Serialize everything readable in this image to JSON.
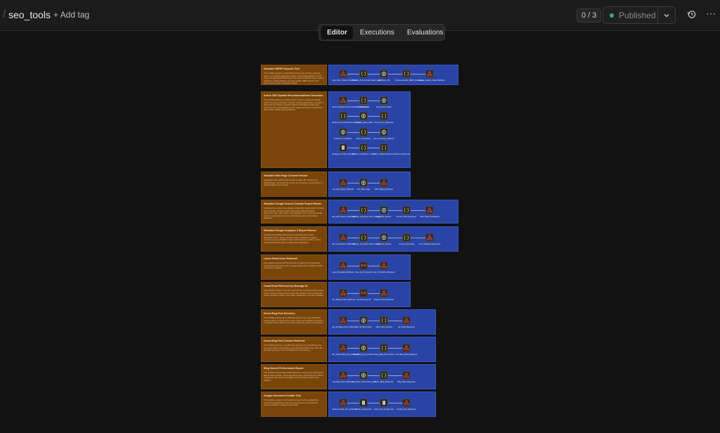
{
  "header": {
    "workflow_name": "seo_tools",
    "add_tag_label": "+ Add tag",
    "counter": "0 / 3",
    "publish_label": "Published",
    "icons": {
      "dropdown": "chevron-down-icon",
      "history": "history-icon",
      "more": "more-horizontal-icon"
    }
  },
  "tabs": [
    {
      "label": "Editor",
      "active": true
    },
    {
      "label": "Executions",
      "active": false
    },
    {
      "label": "Evaluations",
      "active": false
    }
  ],
  "colors": {
    "sticky": "#7a4509",
    "group": "#2944a6",
    "trigger_icon": "#e0484e",
    "code_icon": "#e8b24a",
    "http_icon": "#c8c8c8"
  },
  "sections": [
    {
      "title": "Standard SERP Keyword Tool",
      "description": "This workflow accepts a configurable search query, location, language, device, and a target organization setting, and forwards payload. Use the request through DataForSEO and returns clean structured results, related questions, related searches, top-stories results, SERP features, and optional rank position tracking information.",
      "nodes": [
        {
          "icon": "trigger",
          "label": "Keep_Serp_Search_Webhook"
        },
        {
          "icon": "code",
          "label": "Validate_And_Format_Search_Input"
        },
        {
          "icon": "http",
          "label": "Call_Serp_API"
        },
        {
          "icon": "code",
          "label": "Format_Results_SERP_Response"
        },
        {
          "icon": "trigger",
          "label": "Google_Search_Data_Webhook"
        }
      ]
    },
    {
      "title": "Article SEO Update Recommendations Generator",
      "description": "This workflow gathers an existing article's content, analyzes its Google Search Console performance, identifies ranking opportunities, compares it against the top ranking competitor pages for the target keyword, and returns all of the data needed for an AI model to generate comprehensive SEO content update recommendations.",
      "nodes": [
        {
          "icon": "trigger",
          "label": "Article_Update_Recommendations_Webhook"
        },
        {
          "icon": "code",
          "label": "Validate_Input"
        },
        {
          "icon": "http",
          "label": "Get_Article_Pages"
        },
        {
          "icon": "code",
          "label": "Extract_Recommendations_Content"
        },
        {
          "icon": "http",
          "label": "Get_Gsc_Query_Data"
        },
        {
          "icon": "code",
          "label": "Format_Gsc_Response"
        },
        {
          "icon": "http",
          "label": "Retrieve_Competitors"
        },
        {
          "icon": "code",
          "label": "Filter_Competitors"
        },
        {
          "icon": "http",
          "label": "Get_Competitor_Webinfo"
        },
        {
          "icon": "page",
          "label": "Webpage_Content_Extractor"
        },
        {
          "icon": "code",
          "label": "Extract_Competitor_Content"
        },
        {
          "icon": "code",
          "label": "Article_Update_Recommendations_Response"
        }
      ]
    },
    {
      "title": "Standard Web Page Content Fetcher",
      "description": "Lightweight utility workflow that accepts a public URL, retrieves the rendered page, and returns the content for summaries, summarization, or further analysis by an AI agent.",
      "nodes": [
        {
          "icon": "trigger",
          "label": "Get_Web_Page_Webhook"
        },
        {
          "icon": "http",
          "label": "Get_Web_Page"
        },
        {
          "icon": "trigger",
          "label": "Web_Page_Response"
        }
      ]
    },
    {
      "title": "Standard Google Search Console Report Router",
      "description": "Schedule this workflow that validates configurable Google Search Console report requests, retrieves search performance data with custom dimensions, filters, date ranges, and pagination, then returns appropriate results as structured output to a connected AI agent or downstream application.",
      "nodes": [
        {
          "icon": "trigger",
          "label": "Get_GSC_Report_Webhook"
        },
        {
          "icon": "code",
          "label": "Validate_And_Build_GSC_Request"
        },
        {
          "icon": "http",
          "label": "Get_GSC_Report"
        },
        {
          "icon": "code",
          "label": "Format_GSC_Response"
        },
        {
          "icon": "trigger",
          "label": "GSC_Report_Response"
        }
      ]
    },
    {
      "title": "Standard Google Analytics 4 Report Runner",
      "description": "Schedule this workflow that accepts configurable GA4 metrics, dimensions, filters, sorting, and date ranges, validates the request, executes a Google Analytics 4 report, and returns the results in a clean, structured format for agents or downstream applications.",
      "nodes": [
        {
          "icon": "trigger",
          "label": "Get_GA4_Report_Webhook"
        },
        {
          "icon": "code",
          "label": "Validate_And_Build_GA4_Request"
        },
        {
          "icon": "http",
          "label": "GA4_Run_Report"
        },
        {
          "icon": "code",
          "label": "Format_GA4_Data"
        },
        {
          "icon": "trigger",
          "label": "GA4_Webhook_Response"
        }
      ]
    },
    {
      "title": "Latest Email Inbox Retrieval",
      "description": "This workflow retrieves the 50 most recent emails from the connected Gmail account and returns their message details and metadata for further processing or analysis.",
      "nodes": [
        {
          "icon": "trigger",
          "label": "Last_10_Emails_Webhook"
        },
        {
          "icon": "gmail",
          "label": "Get_Last_10_Emails"
        },
        {
          "icon": "trigger",
          "label": "Last_10_Emails_Response"
        }
      ]
    },
    {
      "title": "Gmail Email Retrieval by Message ID",
      "description": "This workflow retrieves a specific email from the connected Gmail account using a unique message ID and returns the complete email, including the sender, recipients, subject, body, labels, attachments, and other metadata.",
      "nodes": [
        {
          "icon": "trigger",
          "label": "Get_Single_Email_Webhook"
        },
        {
          "icon": "gmail",
          "label": "Get_Email_By_ID"
        },
        {
          "icon": "trigger",
          "label": "Single_Email_Response"
        }
      ]
    },
    {
      "title": "Demo Blog Post Directory",
      "description": "This workflow retrieves up to 100 blog posts from the demo WordPress website, cleans up each post's ID, title, excerpt, last modified, and returns a simplified content directory for content discovery, auditing, and selection.",
      "nodes": [
        {
          "icon": "trigger",
          "label": "Get_All_Blog_Posts_Webhook"
        },
        {
          "icon": "http",
          "label": "Get_All_Blog_Posts"
        },
        {
          "icon": "code",
          "label": "Clean_Blog_Results"
        },
        {
          "icon": "trigger",
          "label": "All_Posts_Response"
        }
      ]
    },
    {
      "title": "Demo Blog Post Content Retrieval",
      "description": "This workflow retrieves a specific demo blog post by its WordPress post ID, returns HTML and formatting, and returns the post ID, slug, URL, title, and clean plain-text content for analysis or AI processing.",
      "nodes": [
        {
          "icon": "trigger",
          "label": "Get_Single_Blog_Post_Webhook"
        },
        {
          "icon": "http",
          "label": "Get_Blog_Post_Content"
        },
        {
          "icon": "code",
          "label": "Clean_Blog_Post_Result"
        },
        {
          "icon": "trigger",
          "label": "Get_Blog_Post_Response"
        }
      ]
    },
    {
      "title": "Blog Search Performance Report",
      "description": "This workflow retrieves Blog Performance from search query performance data for demo website, returns and search query performance for visibility, engagement, and returns a simplified report for content performance analysis.",
      "nodes": [
        {
          "icon": "trigger",
          "label": "Get_Blog_Data_Webhook"
        },
        {
          "icon": "http",
          "label": "Get_Blog_Performance_Data"
        },
        {
          "icon": "code",
          "label": "Clean_Blog_Response"
        },
        {
          "icon": "trigger",
          "label": "Blog_Data_Response"
        }
      ]
    },
    {
      "title": "Google Document Creator Tool",
      "description": "This workflow creates a new Google Document with a specified title, inserts the provided text content into the document, and returns the document details, including its ID and URL.",
      "nodes": [
        {
          "icon": "trigger",
          "label": "Create_Google_Doc_Webhook"
        },
        {
          "icon": "page",
          "label": "Create_Google_Doc"
        },
        {
          "icon": "page",
          "label": "Insert_Into_Google_Doc"
        },
        {
          "icon": "trigger",
          "label": "Google_Doc_Response"
        }
      ]
    }
  ]
}
